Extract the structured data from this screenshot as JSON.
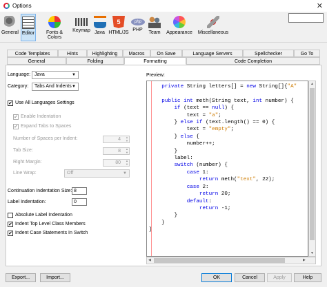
{
  "window": {
    "title": "Options",
    "close_glyph": "✕"
  },
  "search": {
    "placeholder": ""
  },
  "toolbar": {
    "items": [
      {
        "label": "General",
        "icon": "gears-icon"
      },
      {
        "label": "Editor",
        "icon": "editor-icon",
        "selected": true
      },
      {
        "label": "Fonts & Colors",
        "icon": "palette-icon"
      },
      {
        "label": "Keymap",
        "icon": "keyboard-icon"
      },
      {
        "label": "Java",
        "icon": "java-cup-icon"
      },
      {
        "label": "HTML/JS",
        "icon": "html5-icon",
        "badge": "5"
      },
      {
        "label": "PHP",
        "icon": "php-icon",
        "badge": "php"
      },
      {
        "label": "Team",
        "icon": "team-icon"
      },
      {
        "label": "Appearance",
        "icon": "appearance-icon"
      },
      {
        "label": "Miscellaneous",
        "icon": "misc-icon"
      }
    ]
  },
  "tabs_row1": [
    "Code Templates",
    "Hints",
    "Highlighting",
    "Macros",
    "On Save",
    "Language Servers",
    "Spellchecker",
    "Go To"
  ],
  "tabs_row2": [
    "General",
    "Folding",
    "Formatting",
    "Code Completion"
  ],
  "active_tab": "Formatting",
  "form": {
    "language_label": "Language:",
    "language_value": "Java",
    "category_label": "Category:",
    "category_value": "Tabs And Indents",
    "use_all_label": "Use All Languages Settings",
    "enable_indentation_label": "Enable Indentation",
    "expand_tabs_label": "Expand Tabs to Spaces",
    "spaces_per_indent_label": "Number of Spaces per Indent:",
    "spaces_per_indent_value": "4",
    "tab_size_label": "Tab Size:",
    "tab_size_value": "8",
    "right_margin_label": "Right Margin:",
    "right_margin_value": "80",
    "line_wrap_label": "Line Wrap:",
    "line_wrap_value": "Off",
    "continuation_label": "Continuation Indentation Size:",
    "continuation_value": "8",
    "label_indentation_label": "Label Indentation:",
    "label_indentation_value": "0",
    "absolute_label_label": "Absolute Label Indentation",
    "indent_top_level_label": "Indent Top Level Class Members",
    "indent_case_label": "Indent Case Statements In Switch",
    "check_mark": "✔"
  },
  "preview": {
    "label": "Preview:",
    "lines": [
      [
        [
          "    ",
          ""
        ],
        [
          "private",
          "kw"
        ],
        [
          " String letters[] = ",
          ""
        ],
        [
          "new",
          "kw"
        ],
        [
          " String[]{",
          ""
        ],
        [
          "\"A\"",
          "str"
        ]
      ],
      [
        [
          "",
          ""
        ]
      ],
      [
        [
          "    ",
          ""
        ],
        [
          "public",
          "kw"
        ],
        [
          " ",
          ""
        ],
        [
          "int",
          "kw"
        ],
        [
          " meth(String text, ",
          ""
        ],
        [
          "int",
          "kw"
        ],
        [
          " number) {",
          ""
        ]
      ],
      [
        [
          "        ",
          ""
        ],
        [
          "if",
          "kw"
        ],
        [
          " (text == ",
          ""
        ],
        [
          "null",
          "kw"
        ],
        [
          ") {",
          ""
        ]
      ],
      [
        [
          "            text = ",
          ""
        ],
        [
          "\"a\"",
          "str"
        ],
        [
          ";",
          ""
        ]
      ],
      [
        [
          "        } ",
          ""
        ],
        [
          "else",
          "kw"
        ],
        [
          " ",
          ""
        ],
        [
          "if",
          "kw"
        ],
        [
          " (text.length() == 0) {",
          ""
        ]
      ],
      [
        [
          "            text = ",
          ""
        ],
        [
          "\"empty\"",
          "str"
        ],
        [
          ";",
          ""
        ]
      ],
      [
        [
          "        } ",
          ""
        ],
        [
          "else",
          "kw"
        ],
        [
          " {",
          ""
        ]
      ],
      [
        [
          "            number++;",
          ""
        ]
      ],
      [
        [
          "        }",
          ""
        ]
      ],
      [
        [
          "        label:",
          ""
        ]
      ],
      [
        [
          "        ",
          ""
        ],
        [
          "switch",
          "kw"
        ],
        [
          " (number) {",
          ""
        ]
      ],
      [
        [
          "            ",
          ""
        ],
        [
          "case",
          "kw"
        ],
        [
          " 1:",
          ""
        ]
      ],
      [
        [
          "                ",
          ""
        ],
        [
          "return",
          "kw"
        ],
        [
          " meth(",
          ""
        ],
        [
          "\"text\"",
          "str"
        ],
        [
          ", 22);",
          ""
        ]
      ],
      [
        [
          "            ",
          ""
        ],
        [
          "case",
          "kw"
        ],
        [
          " 2:",
          ""
        ]
      ],
      [
        [
          "                ",
          ""
        ],
        [
          "return",
          "kw"
        ],
        [
          " 20;",
          ""
        ]
      ],
      [
        [
          "            ",
          ""
        ],
        [
          "default",
          "kw"
        ],
        [
          ":",
          ""
        ]
      ],
      [
        [
          "                ",
          ""
        ],
        [
          "return",
          "kw"
        ],
        [
          " -1;",
          ""
        ]
      ],
      [
        [
          "        }",
          ""
        ]
      ],
      [
        [
          "    }",
          ""
        ]
      ],
      [
        [
          "}",
          ""
        ]
      ]
    ]
  },
  "buttons": {
    "export": "Export...",
    "import": "Import...",
    "ok": "OK",
    "cancel": "Cancel",
    "apply": "Apply",
    "help": "Help"
  }
}
